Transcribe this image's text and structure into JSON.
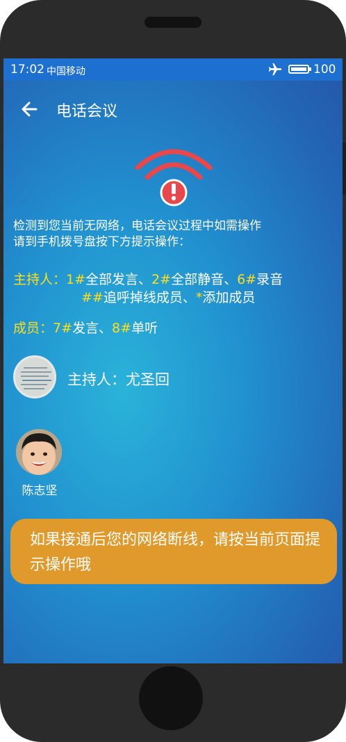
{
  "status_bar": {
    "time": "17:02",
    "carrier": "中国移动",
    "battery": "100",
    "icons": [
      "airplane-icon",
      "battery-icon"
    ]
  },
  "header": {
    "title": "电话会议",
    "back_icon": "arrow-left-icon"
  },
  "alert": {
    "icon": "wifi-alert-icon",
    "line1": "检测到您当前无网络，电话会议过程中如需操作",
    "line2": "请到手机拨号盘按下方提示操作："
  },
  "host_commands": {
    "label": "主持人：",
    "line1": [
      {
        "key": "1#",
        "text": "全部发言、"
      },
      {
        "key": "2#",
        "text": "全部静音、"
      },
      {
        "key": "6#",
        "text": "录音"
      }
    ],
    "line2": [
      {
        "key": "##",
        "text": "追呼掉线成员、"
      },
      {
        "key": "*",
        "text": "添加成员"
      }
    ]
  },
  "member_commands": {
    "label": "成员：",
    "items": [
      {
        "key": "7#",
        "text": "发言、"
      },
      {
        "key": "8#",
        "text": "单听"
      }
    ]
  },
  "host": {
    "name": "主持人：尤圣回"
  },
  "member": {
    "name": "陈志坚"
  },
  "tip": {
    "text": "如果接通后您的网络断线，请按当前页面提示操作哦"
  },
  "colors": {
    "key_yellow": "#ffde1c",
    "status_bar": "#1d6fd0",
    "tip_orange": "#e0992b",
    "icon_red": "#e8474b"
  }
}
